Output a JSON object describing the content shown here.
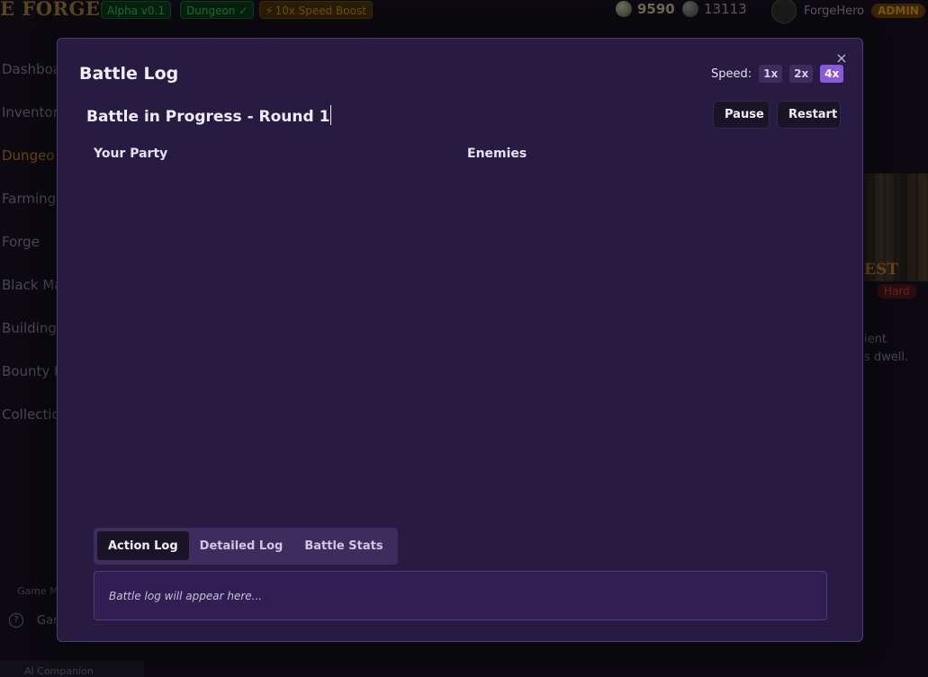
{
  "background": {
    "logo": "E FORGE",
    "badges": {
      "alpha": "Alpha v0.1",
      "dungeon": "Dungeon ✓",
      "speed_icon": "⚡",
      "speed": "10x Speed Boost"
    },
    "resources": {
      "gold": "9590",
      "gems": "13113"
    },
    "user": {
      "name": "ForgeHero",
      "role": "ADMIN"
    },
    "sidebar": {
      "items": [
        "Dashboa",
        "Inventor",
        "Dungeo",
        "Farming",
        "Forge",
        "Black Ma",
        "Buildings",
        "Bounty B",
        "Collectio"
      ],
      "footer_label": "Game M",
      "footer_item": "Gar",
      "footer_item2": "AI Companion"
    },
    "card": {
      "title": "EST",
      "difficulty": "Hard",
      "desc_line1": "ient",
      "desc_line2": "s dwell."
    }
  },
  "modal": {
    "title": "Battle Log",
    "close_icon": "×",
    "speed": {
      "label": "Speed:",
      "options": [
        "1x",
        "2x",
        "4x"
      ],
      "selected": "4x"
    },
    "battle_heading": "Battle in Progress - Round 1",
    "controls": {
      "pause": "Pause",
      "restart": "Restart"
    },
    "columns": {
      "party": "Your Party",
      "enemies": "Enemies"
    },
    "tabs": [
      "Action Log",
      "Detailed Log",
      "Battle Stats"
    ],
    "active_tab": "Action Log",
    "log_placeholder": "Battle log will appear here..."
  },
  "colors": {
    "modal_bg": "#271b41",
    "accent": "#8b5ad8",
    "log_bg": "#311e52"
  }
}
